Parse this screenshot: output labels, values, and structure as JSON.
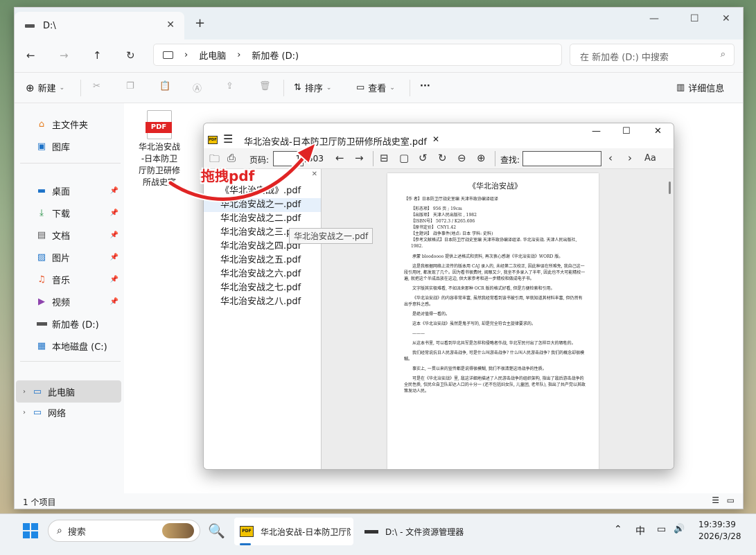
{
  "explorer": {
    "tab_title": "D:\\",
    "address": {
      "root": "此电脑",
      "drive": "新加卷 (D:)"
    },
    "search_placeholder": "在 新加卷 (D:) 中搜索",
    "toolbar": {
      "new": "新建",
      "sort": "排序",
      "view": "查看",
      "more": "···",
      "details": "详细信息"
    },
    "sidebar": {
      "items": [
        {
          "label": "主文件夹",
          "icon": "home-icon"
        },
        {
          "label": "图库",
          "icon": "gallery-icon"
        },
        {
          "label": "桌面",
          "icon": "desktop-icon"
        },
        {
          "label": "下载",
          "icon": "download-icon"
        },
        {
          "label": "文档",
          "icon": "document-icon"
        },
        {
          "label": "图片",
          "icon": "pictures-icon"
        },
        {
          "label": "音乐",
          "icon": "music-icon"
        },
        {
          "label": "视频",
          "icon": "video-icon"
        },
        {
          "label": "新加卷 (D:)",
          "icon": "drive-icon"
        },
        {
          "label": "本地磁盘 (C:)",
          "icon": "drive-c-icon"
        },
        {
          "label": "此电脑",
          "icon": "computer-icon"
        },
        {
          "label": "网络",
          "icon": "network-icon"
        }
      ]
    },
    "file": {
      "badge": "PDF",
      "line1": "华北治安战",
      "line2": "-日本防卫",
      "line3": "厅防卫研修",
      "line4": "所战史室"
    },
    "status": "1 个项目"
  },
  "annotation": {
    "drag_label": "拖拽pdf"
  },
  "pdf_viewer": {
    "title": "华北治安战-日本防卫厅防卫研修所战史室.pdf",
    "page_label": "页码:",
    "page_value": "1",
    "page_total": "/503",
    "find_label": "查找:",
    "list": [
      "《华北治安战》.pdf",
      "华北治安战之一.pdf",
      "华北治安战之二.pdf",
      "华北治安战之三.pdf",
      "华北治安战之四.pdf",
      "华北治安战之五.pdf",
      "华北治安战之六.pdf",
      "华北治安战之七.pdf",
      "华北治安战之八.pdf"
    ],
    "tooltip": "华北治安战之一.pdf",
    "page": {
      "title": "《华北治安战》",
      "author": "【作 者】日本防卫厅战史室编 天津市政协编译组译",
      "bullets": [
        "【形态项】 956 页 ; 19cm",
        "【出版项】 天津人民出版社 , 1982",
        "【ISBN号】 5072.3 / K265.606",
        "【原书定价】 CNY1.42",
        "【主题词】 战争事件(地点: 日本 学科: 史料)",
        "【参考文献格式】日本防卫厅战史室编 天津市政协编译组译. 华北治安战. 天津人民出版社, 1982."
      ],
      "paras": [
        "承蒙 bloodoooo 提供上述格式和资料, 再次衷心感谢《华北治安战》WORD 版。",
        "这是我根据网络上流传的版本用 CAJ 录入的, 未经第二次校正, 因此种误在所难免, 我自己这一段引用时, 都发现了几个。因为看书很费时, 阅眼又少, 我坐不多录入了半年, 因此也不大可能精校一遍, 就把这个半成品放在这边, 供大家参考和进一步精校和做成电子书。",
        "文字版其实极难看, 不如派来那种 OCR 版的格式好看, 但是方便检索和引用。",
        "《华北治安战》的内容非常丰富, 虽然我经常看到该书被引用, 早就知道其材料丰富, 但仍然有出乎意料之感。",
        "是绝对值得一看的。",
        "这本《华北治安战》虽然是鬼子写的, 却是完全符合主旋律要求的。",
        "———",
        "从这本书里, 可以看到华北共军是怎样和侵略者作战, 华北军民付出了怎样巨大的牺牲的。",
        "我们经常说抗日人民游击战争, 可是什么叫游击战争? 什么叫人民游击战争? 我们的概念却很模糊。",
        "事实上, 一贯以来的宣传都是说得很模糊, 我们不很清楚这场战争的性质。",
        "可是在《华北治安战》里, 敌这详细地描述了人民游击战争的组织架构, 指出了敌后游击战争的全民性质, 仅民众自卫队却达人口的十分一 (还不包括妇女队, 儿童团, 老年队), 指出了共产党以其政策发动人民。"
      ]
    }
  },
  "taskbar": {
    "search": "搜索",
    "apps": [
      {
        "label": "华北治安战-日本防卫厅防",
        "icon": "pdf-app-icon"
      },
      {
        "label": "D:\\ - 文件资源管理器",
        "icon": "file-explorer-icon"
      }
    ],
    "ime": "中",
    "time": "19:39:39",
    "date": "2026/3/28"
  }
}
